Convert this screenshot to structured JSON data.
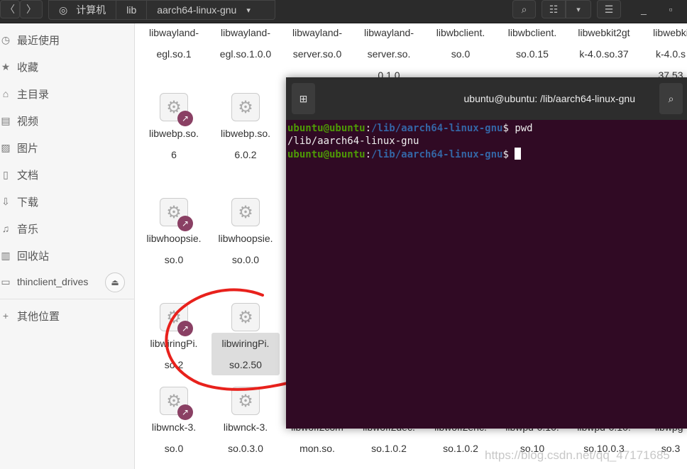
{
  "header": {
    "back": "〈",
    "forward": "〉",
    "crumbs": [
      "计算机",
      "lib",
      "aarch64-linux-gnu"
    ],
    "dropdown": "▾",
    "search": "⌕",
    "view": "☷",
    "view_menu": "▾",
    "menu": "☰",
    "minimize": "_",
    "maximize": "▫"
  },
  "sidebar": {
    "items": [
      {
        "icon": "clock",
        "label": "最近使用"
      },
      {
        "icon": "star",
        "label": "收藏"
      },
      {
        "icon": "home",
        "label": "主目录"
      },
      {
        "icon": "video",
        "label": "视频"
      },
      {
        "icon": "image",
        "label": "图片"
      },
      {
        "icon": "document",
        "label": "文档"
      },
      {
        "icon": "download",
        "label": "下载"
      },
      {
        "icon": "music",
        "label": "音乐"
      },
      {
        "icon": "trash",
        "label": "回收站"
      },
      {
        "icon": "drive",
        "label": "thinclient_drives"
      },
      {
        "icon": "plus",
        "label": "其他位置"
      }
    ]
  },
  "files": [
    {
      "l1": "libwayland-",
      "l2": "egl.so.1",
      "l3": ""
    },
    {
      "l1": "libwayland-",
      "l2": "egl.so.1.0.0",
      "l3": ""
    },
    {
      "l1": "libwayland-",
      "l2": "server.so.0",
      "l3": ""
    },
    {
      "l1": "libwayland-",
      "l2": "server.so.",
      "l3": "0.1.0"
    },
    {
      "l1": "libwbclient.",
      "l2": "so.0",
      "l3": ""
    },
    {
      "l1": "libwbclient.",
      "l2": "so.0.15",
      "l3": ""
    },
    {
      "l1": "libwebkit2gt",
      "l2": "k-4.0.so.37",
      "l3": ""
    },
    {
      "l1": "libwebki",
      "l2": "k-4.0.s",
      "l3": "37.53"
    },
    {
      "l1": "libwebp.so.",
      "l2": "6",
      "link": true
    },
    {
      "l1": "libwebp.so.",
      "l2": "6.0.2"
    },
    {
      "l1": "libwhoopsie.",
      "l2": "so.0",
      "link": true
    },
    {
      "l1": "libwhoopsie.",
      "l2": "so.0.0"
    },
    {
      "l1": "libwiringPi.",
      "l2": "so.2",
      "link": true
    },
    {
      "l1": "libwiringPi.",
      "l2": "so.2.50",
      "selected": true
    },
    {
      "l1": "libwnck-3.",
      "l2": "so.0",
      "link": true
    },
    {
      "l1": "libwnck-3.",
      "l2": "so.0.3.0"
    },
    {
      "l1": "libwoff2com",
      "l2": "mon.so."
    },
    {
      "l1": "libwoff2dec.",
      "l2": "so.1.0.2"
    },
    {
      "l1": "libwoff2enc.",
      "l2": "so.1.0.2"
    },
    {
      "l1": "libwpd-0.10.",
      "l2": "so.10"
    },
    {
      "l1": "libwpd-0.10.",
      "l2": "so.10.0.3"
    },
    {
      "l1": "libwpg-",
      "l2": "so.3"
    }
  ],
  "terminal": {
    "title": "ubuntu@ubuntu: /lib/aarch64-linux-gnu",
    "user": "ubuntu@ubuntu",
    "path": "/lib/aarch64-linux-gnu",
    "command": "pwd",
    "output": "/lib/aarch64-linux-gnu",
    "new_tab": "⊞",
    "search": "⌕"
  },
  "watermark": "https://blog.csdn.net/qq_47171685",
  "colors": {
    "terminal_bg": "#300a24",
    "annotation": "#e8211c",
    "link_badge": "#8a4064"
  }
}
